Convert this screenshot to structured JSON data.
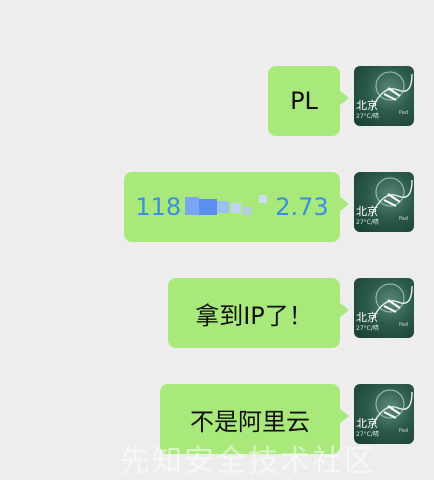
{
  "messages": [
    {
      "text": "PL"
    },
    {
      "prefix": "118",
      "suffix": "2.73",
      "redacted": true
    },
    {
      "text": "拿到IP了！"
    },
    {
      "text": "不是阿里云"
    }
  ],
  "avatar": {
    "city": "北京",
    "weather": "27°C/晴",
    "mark": "Pad"
  },
  "watermark": "先知安全技术社区",
  "colors": {
    "background": "#ededed",
    "bubble": "#a9e87a",
    "link": "#3b8fe0"
  }
}
